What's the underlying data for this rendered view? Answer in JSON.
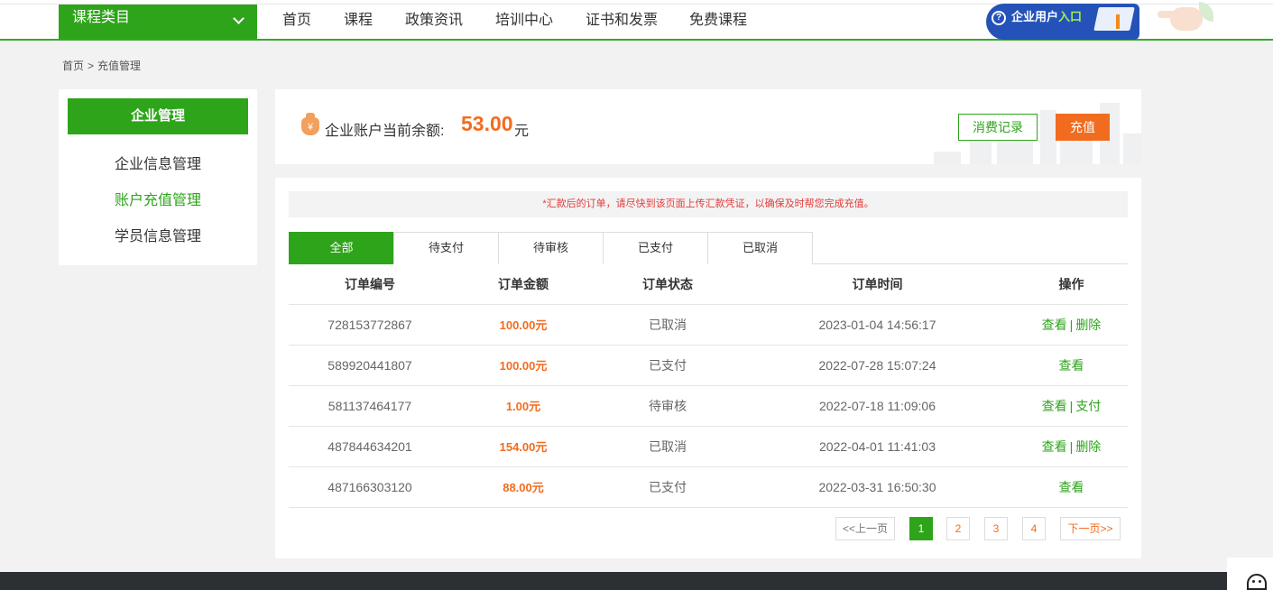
{
  "header": {
    "category_label": "课程类目",
    "nav": [
      "首页",
      "课程",
      "政策资讯",
      "培训中心",
      "证书和发票",
      "免费课程"
    ],
    "enterprise_entry": {
      "prefix": "企业用户",
      "accent": "入口"
    }
  },
  "breadcrumb": {
    "home": "首页",
    "separator": ">",
    "current": "充值管理"
  },
  "sidebar": {
    "title": "企业管理",
    "items": [
      {
        "label": "企业信息管理",
        "active": false
      },
      {
        "label": "账户充值管理",
        "active": true
      },
      {
        "label": "学员信息管理",
        "active": false
      }
    ]
  },
  "balance": {
    "label": "企业账户当前余额:",
    "amount": "53.00",
    "unit": "元",
    "records_button": "消费记录",
    "recharge_button": "充值"
  },
  "notice": "*汇款后的订单，请尽快到该页面上传汇款凭证，以确保及时帮您完成充值。",
  "tabs": [
    {
      "label": "全部",
      "active": true
    },
    {
      "label": "待支付",
      "active": false
    },
    {
      "label": "待审核",
      "active": false
    },
    {
      "label": "已支付",
      "active": false
    },
    {
      "label": "已取消",
      "active": false
    }
  ],
  "table": {
    "headers": [
      "订单编号",
      "订单金额",
      "订单状态",
      "订单时间",
      "操作"
    ],
    "rows": [
      {
        "id": "728153772867",
        "amount": "100.00元",
        "status": "已取消",
        "time": "2023-01-04 14:56:17",
        "ops": [
          "查看",
          "删除"
        ]
      },
      {
        "id": "589920441807",
        "amount": "100.00元",
        "status": "已支付",
        "time": "2022-07-28 15:07:24",
        "ops": [
          "查看"
        ]
      },
      {
        "id": "581137464177",
        "amount": "1.00元",
        "status": "待审核",
        "time": "2022-07-18 11:09:06",
        "ops": [
          "查看",
          "支付"
        ]
      },
      {
        "id": "487844634201",
        "amount": "154.00元",
        "status": "已取消",
        "time": "2022-04-01 11:41:03",
        "ops": [
          "查看",
          "删除"
        ]
      },
      {
        "id": "487166303120",
        "amount": "88.00元",
        "status": "已支付",
        "time": "2022-03-31 16:50:30",
        "ops": [
          "查看"
        ]
      }
    ],
    "op_separator": "|"
  },
  "pagination": {
    "prev": "<<上一页",
    "pages": [
      "1",
      "2",
      "3",
      "4"
    ],
    "current": "1",
    "next": "下一页>>"
  },
  "colors": {
    "brand_green": "#2ea41b",
    "accent_orange": "#f26c1f",
    "notice_red": "#e23c3c"
  }
}
